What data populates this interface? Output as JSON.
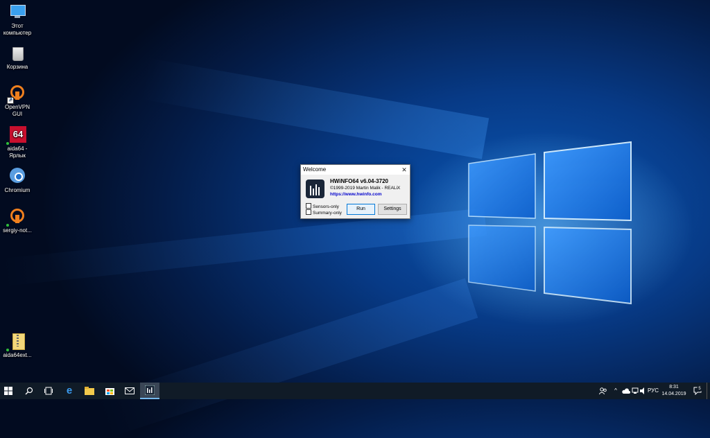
{
  "desktop": {
    "icons": [
      {
        "label": "Этот компьютер",
        "icon": "computer-icon"
      },
      {
        "label": "Корзина",
        "icon": "recycle-bin-icon"
      },
      {
        "label": "OpenVPN GUI",
        "icon": "openvpn-icon"
      },
      {
        "label": "aida64 - Ярлык",
        "icon": "aida64-icon"
      },
      {
        "label": "Chromium",
        "icon": "chromium-icon"
      },
      {
        "label": "sergiy-not...",
        "icon": "openvpn-config-icon"
      },
      {
        "label": "aida64ext...",
        "icon": "archive-folder-icon"
      }
    ]
  },
  "dialog": {
    "title": "Welcome",
    "close_glyph": "✕",
    "app_name": "HWiNFO64 v6.04-3720",
    "copyright": "©1999-2019 Martin Malik - REALiX",
    "url": "https://www.hwinfo.com",
    "options": [
      {
        "label": "Sensors-only",
        "checked": false
      },
      {
        "label": "Summary-only",
        "checked": false
      }
    ],
    "run_label": "Run",
    "settings_label": "Settings"
  },
  "taskbar": {
    "start_icon": "windows-start-icon",
    "pinned": [
      "search-icon",
      "task-view-icon",
      "edge-icon",
      "file-explorer-icon",
      "store-icon",
      "mail-icon",
      "hwinfo-icon"
    ],
    "active": "hwinfo-icon",
    "tray": {
      "language": "РУС",
      "time": "8:31",
      "date": "14.04.2019",
      "notifications_count": "5"
    }
  },
  "colors": {
    "accent": "#0078d7",
    "taskbar_bg": "#101b27",
    "link": "#0000cc"
  }
}
